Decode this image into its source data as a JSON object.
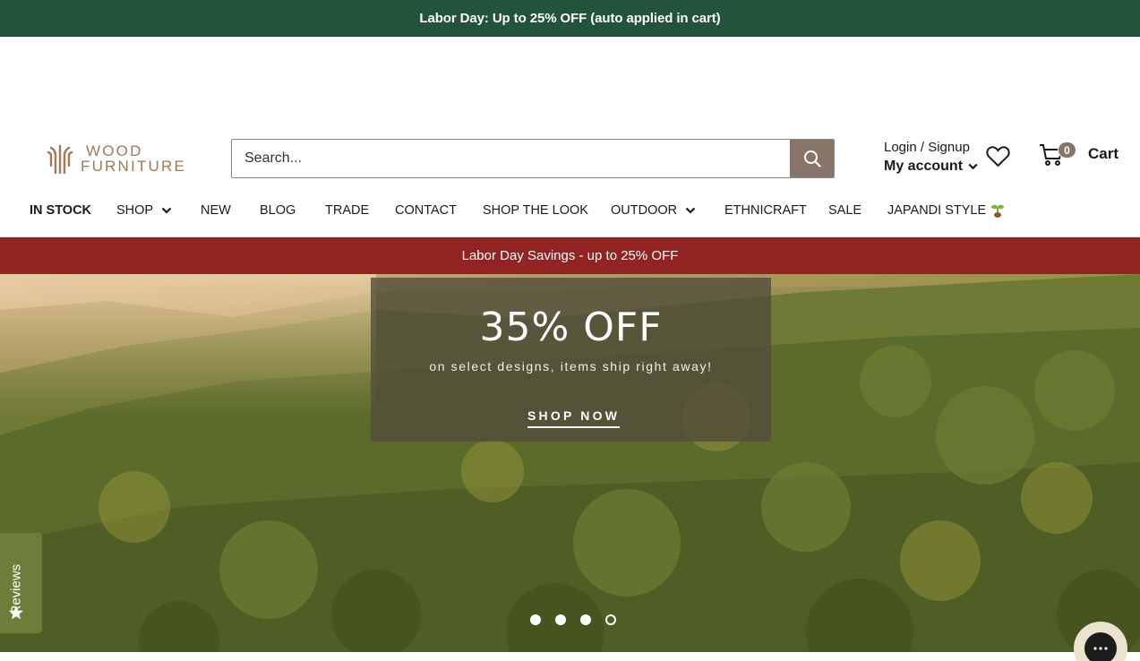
{
  "announcement": {
    "text": "Labor Day: Up to 25% OFF (auto applied in cart)"
  },
  "header": {
    "logo": {
      "line1": "WOOD",
      "line2": "FURNITURE"
    },
    "search": {
      "placeholder": "Search...",
      "icon": "search-icon"
    },
    "account": {
      "login_text": "Login / Signup",
      "account_text": "My account"
    },
    "wishlist": {
      "icon": "heart-icon"
    },
    "cart": {
      "count": "0",
      "label": "Cart",
      "icon": "cart-icon"
    }
  },
  "nav": {
    "items": [
      {
        "label": "IN STOCK"
      },
      {
        "label": "SHOP"
      },
      {
        "label": "NEW"
      },
      {
        "label": "BLOG"
      },
      {
        "label": "TRADE"
      },
      {
        "label": "CONTACT"
      },
      {
        "label": "SHOP THE LOOK"
      },
      {
        "label": "OUTDOOR"
      },
      {
        "label": "ETHNICRAFT"
      },
      {
        "label": "SALE"
      },
      {
        "label": "JAPANDI STYLE"
      }
    ]
  },
  "promo_bar": {
    "text": "Labor Day Savings - up to 25% OFF"
  },
  "hero": {
    "title": "35% OFF",
    "subtitle": "on select designs, items ship right away!",
    "cta": "SHOP NOW",
    "slides_total": 4,
    "active_slide": 4
  },
  "reviews_tab": {
    "label": "Reviews",
    "icon": "star-icon"
  },
  "chat": {
    "icon": "chat-icon"
  },
  "colors": {
    "announcement_bg": "#24533c",
    "promo_bg": "#912322",
    "accent": "#877569",
    "logo": "#a07a55",
    "reviews_bg": "#6d7d3a"
  }
}
